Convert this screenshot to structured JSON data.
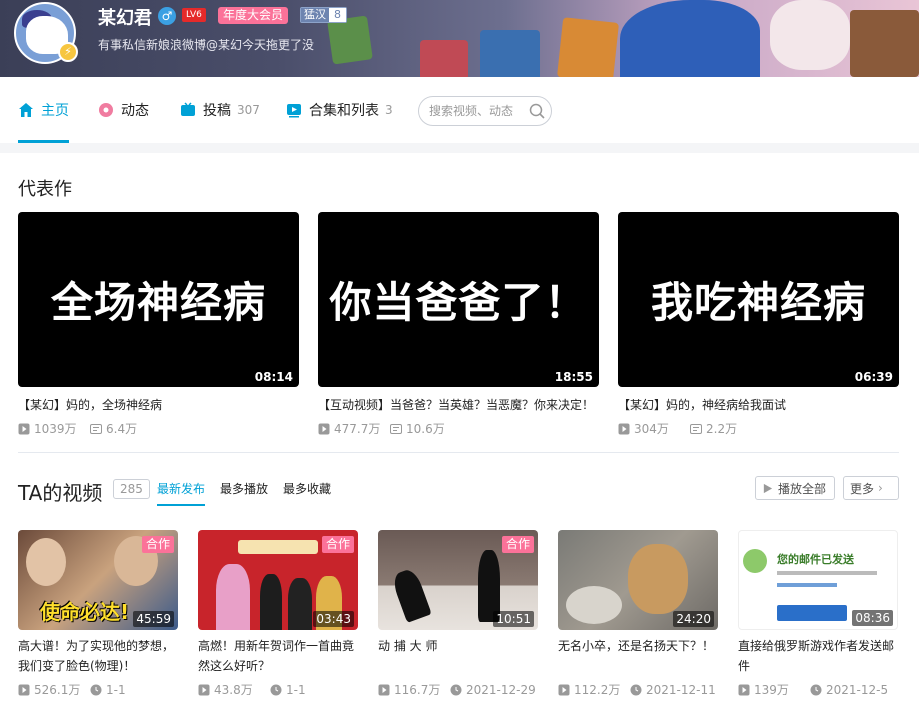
{
  "profile": {
    "name": "某幻君",
    "level": "LV6",
    "vip": "年度大会员",
    "medal_name": "猛汉",
    "medal_level": "8",
    "signature": "有事私信新娘浪微博@某幻今天拖更了没",
    "avatar_badge": "⚡"
  },
  "nav": {
    "home": "主页",
    "dynamic": "动态",
    "uploads": "投稿",
    "uploads_count": "307",
    "collections": "合集和列表",
    "collections_count": "3",
    "search_placeholder": "搜索视频、动态"
  },
  "representative": {
    "title": "代表作",
    "items": [
      {
        "big": "全场神经病",
        "duration": "08:14",
        "name": "【某幻】妈的，全场神经病",
        "plays": "1039万",
        "danmaku": "6.4万"
      },
      {
        "big": "你当爸爸了！",
        "duration": "18:55",
        "name": "【互动视频】当爸爸？当英雄？当恶魔？你来决定！",
        "plays": "477.7万",
        "danmaku": "10.6万"
      },
      {
        "big": "我吃神经病",
        "duration": "06:39",
        "name": "【某幻】妈的，神经病给我面试",
        "plays": "304万",
        "danmaku": "2.2万"
      }
    ]
  },
  "videos": {
    "title": "TA的视频",
    "count": "285",
    "tabs": [
      "最新发布",
      "最多播放",
      "最多收藏"
    ],
    "play_all": "播放全部",
    "more": "更多",
    "items": [
      {
        "tag": "合作",
        "duration": "45:59",
        "title": "高大谱！为了实现他的梦想，我们变了脸色(物理)！",
        "plays": "526.1万",
        "date": "1-1",
        "overlay": "使命必达!"
      },
      {
        "tag": "合作",
        "duration": "03:43",
        "title": "高燃！用新年贺词作一首曲竟然这么好听？",
        "plays": "43.8万",
        "date": "1-1",
        "overlay": ""
      },
      {
        "tag": "合作",
        "duration": "10:51",
        "title": "动 捕 大 师",
        "plays": "116.7万",
        "date": "2021-12-29",
        "overlay": ""
      },
      {
        "tag": "",
        "duration": "24:20",
        "title": "无名小卒，还是名扬天下？！",
        "plays": "112.2万",
        "date": "2021-12-11",
        "overlay": ""
      },
      {
        "tag": "",
        "duration": "08:36",
        "title": "直接给俄罗斯游戏作者发送邮件",
        "plays": "139万",
        "date": "2021-12-5",
        "overlay": "您的邮件已发送"
      }
    ]
  },
  "colors": {
    "accent": "#00a1d6",
    "pink": "#fb7299"
  }
}
